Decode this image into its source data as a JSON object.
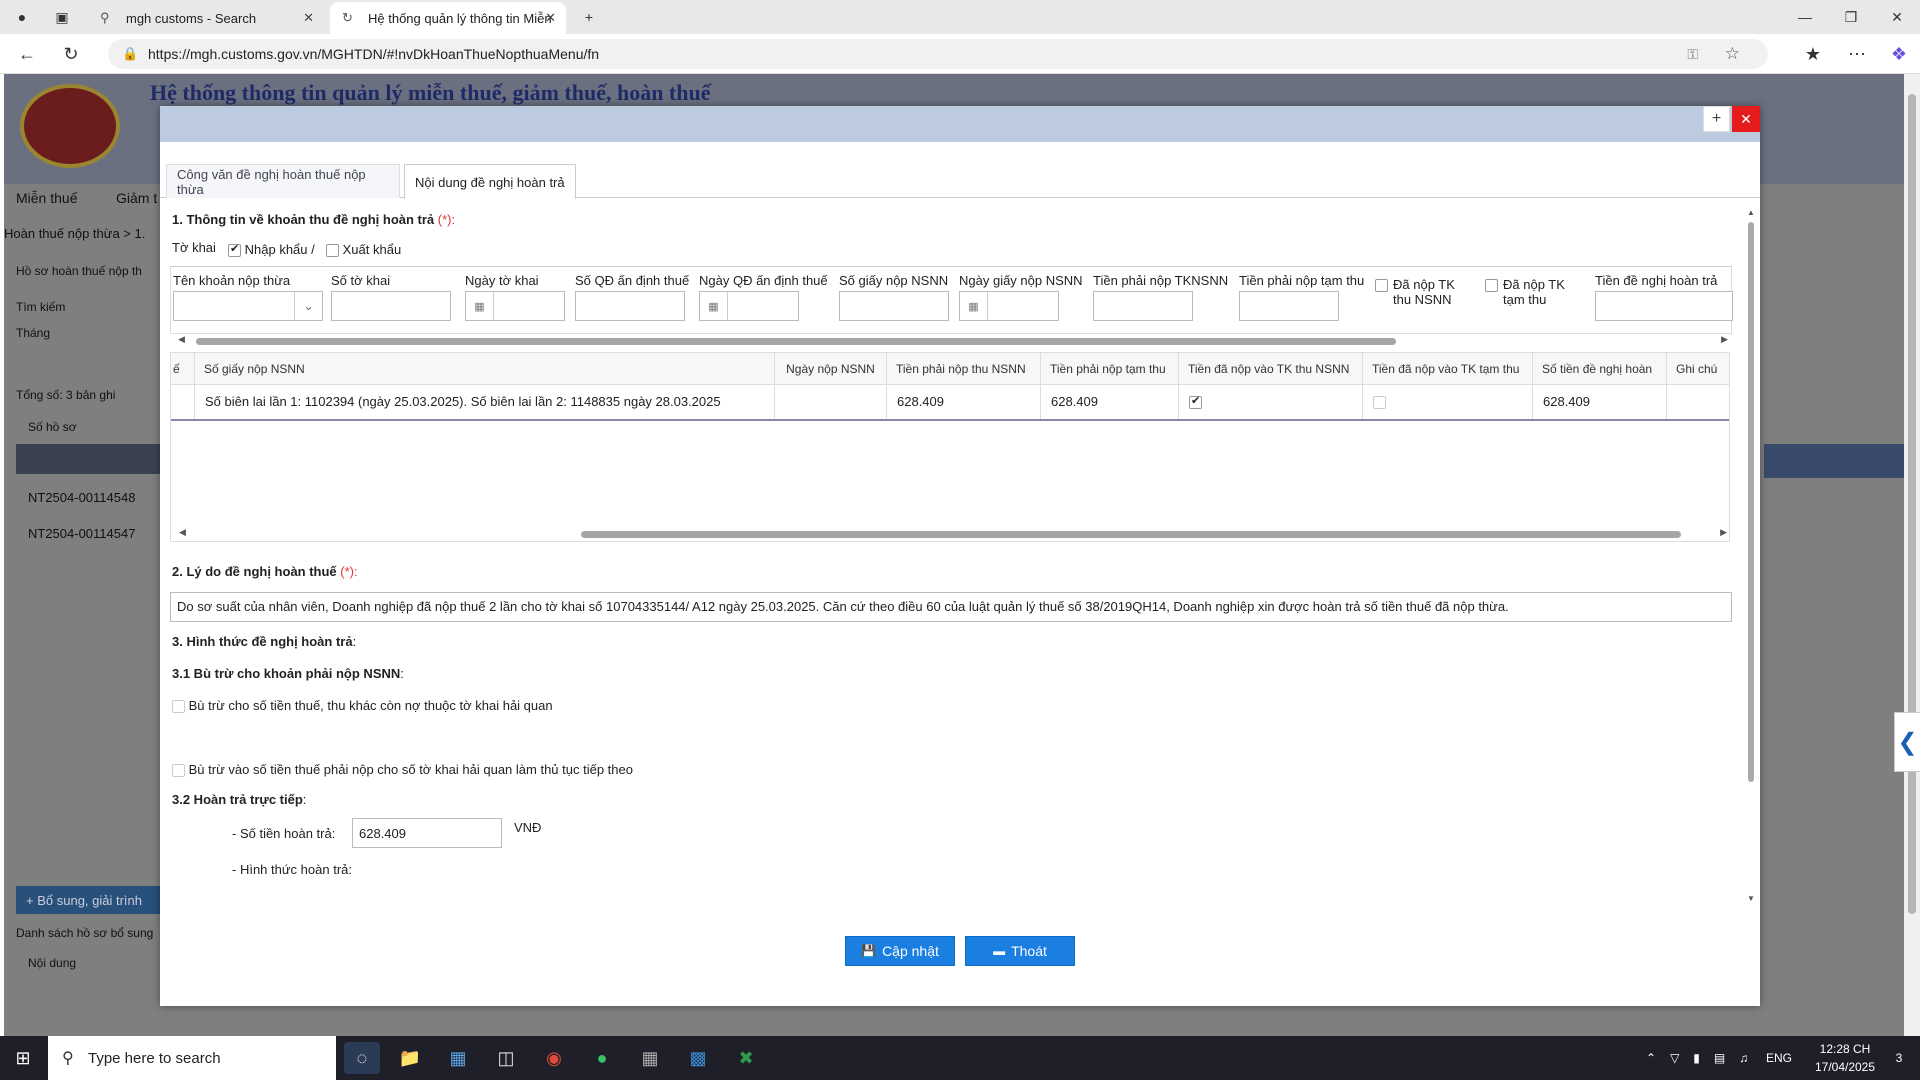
{
  "browser": {
    "tabs": [
      {
        "label": "mgh customs - Search"
      },
      {
        "label": "Hệ thống quản lý thông tin Miễn"
      }
    ],
    "url": "https://mgh.customs.gov.vn/MGHTDN/#!nvDkHoanThueNopthuaMenu/fn"
  },
  "background": {
    "header_title": "Hệ thống thông tin quản lý miễn thuế, giảm thuế, hoàn thuế",
    "menu_1": "Miễn thuế",
    "menu_2": "Giảm t",
    "breadcrumb": "Hoàn thuế nộp thừa > 1.",
    "section": "Hồ sơ hoàn thuế nộp th",
    "search_label": "Tìm kiếm",
    "month_label": "Tháng",
    "total": "Tổng số: 3 bản ghi",
    "col_header": "Số hồ sơ",
    "records": [
      "NT2504-00114548",
      "NT2504-00114547"
    ],
    "add_button": "Bổ sung, giải trình",
    "list_label": "Danh sách hồ sơ bổ sung",
    "content_label": "Nội dung"
  },
  "dialog": {
    "tabs": [
      {
        "label": "Công văn đề nghị hoàn thuế nộp thừa"
      },
      {
        "label": "Nội dung đề nghị hoàn trả"
      }
    ],
    "section1": {
      "title": "1. Thông tin về khoản thu đề nghị hoàn trả",
      "required": "(*):",
      "to_khai_label": "Tờ khai",
      "nhap_khau": "Nhập khẩu /",
      "xuat_khau": "Xuất khẩu",
      "nhap_khau_checked": true,
      "xuat_khau_checked": false,
      "filter_columns": [
        "Tên khoản nộp thừa",
        "Số tờ khai",
        "Ngày tờ khai",
        "Số QĐ ấn định thuế",
        "Ngày QĐ ấn định thuế",
        "Số giấy nộp NSNN",
        "Ngày giấy nộp NSNN",
        "Tiền phải nộp TKNSNN",
        "Tiền phải nộp tạm thu",
        "Đã nộp TK thu NSNN",
        "Đã nộp TK tạm thu",
        "Tiền đề nghị hoàn trả"
      ]
    },
    "grid": {
      "headers": [
        "ế",
        "Số giấy nộp NSNN",
        "Ngày nộp NSNN",
        "Tiền phải nộp thu NSNN",
        "Tiền phải nộp tạm thu",
        "Tiền đã nộp vào TK thu NSNN",
        "Tiền đã nộp vào TK tạm thu",
        "Số tiền đề nghị hoàn",
        "Ghi chú"
      ],
      "rows": [
        {
          "so_giay_nop": "Số biên lai lần 1: 1102394 (ngày 25.03.2025). Số biên lai lần 2: 1148835 ngày 28.03.2025",
          "ngay_nop": "",
          "tien_phai_nop_thu": "628.409",
          "tien_phai_nop_tam_thu": "628.409",
          "da_nop_tk_thu": true,
          "da_nop_tk_tam_thu": false,
          "so_tien_de_nghi": "628.409",
          "ghi_chu": ""
        }
      ]
    },
    "section2": {
      "title": "2. Lý do đề nghị hoàn thuế",
      "required": "(*):",
      "reason": "Do sơ suất của nhân viên, Doanh nghiệp đã nộp thuế 2 lần cho tờ khai số 10704335144/ A12 ngày 25.03.2025. Căn cứ theo điều 60 của luật quản lý thuế số 38/2019QH14, Doanh nghiệp xin được hoàn trả số tiền thuế đã nộp thừa."
    },
    "section3": {
      "title": "3. Hình thức đề nghị hoàn trả",
      "colon": ":",
      "sub1": "3.1 Bù trừ cho khoản phải nộp NSNN",
      "opt1": "Bù trừ cho số tiền thuế, thu khác còn nợ thuộc tờ khai hải quan",
      "opt2": "Bù trừ vào số tiền thuế phải nộp cho số tờ khai hải quan làm thủ tục tiếp theo",
      "sub2": "3.2 Hoàn trả trực tiếp",
      "amount_label": "- Số tiền hoàn trả:",
      "amount_value": "628.409",
      "currency": "VNĐ",
      "method_label": "- Hình thức hoàn trả:"
    },
    "buttons": {
      "update": "Cập nhật",
      "exit": "Thoát"
    }
  },
  "taskbar": {
    "search_placeholder": "Type here to search",
    "lang": "ENG",
    "time": "12:28 CH",
    "date": "17/04/2025",
    "notifications": "3"
  },
  "colors": {
    "primary_button": "#1a7fe0",
    "close_button": "#e61c1c",
    "dialog_title": "#bccbe0"
  }
}
